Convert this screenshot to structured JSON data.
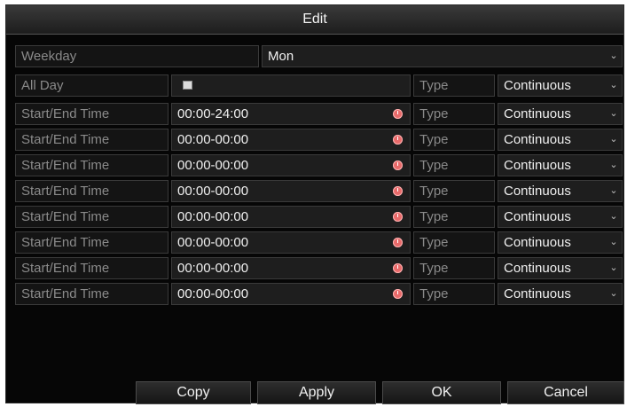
{
  "dialog": {
    "title": "Edit"
  },
  "weekday": {
    "label": "Weekday",
    "value": "Mon"
  },
  "all_day": {
    "label": "All Day",
    "type_label": "Type",
    "type_value": "Continuous"
  },
  "periods": [
    {
      "label": "Start/End Time",
      "time": "00:00-24:00",
      "type_label": "Type",
      "type_value": "Continuous"
    },
    {
      "label": "Start/End Time",
      "time": "00:00-00:00",
      "type_label": "Type",
      "type_value": "Continuous"
    },
    {
      "label": "Start/End Time",
      "time": "00:00-00:00",
      "type_label": "Type",
      "type_value": "Continuous"
    },
    {
      "label": "Start/End Time",
      "time": "00:00-00:00",
      "type_label": "Type",
      "type_value": "Continuous"
    },
    {
      "label": "Start/End Time",
      "time": "00:00-00:00",
      "type_label": "Type",
      "type_value": "Continuous"
    },
    {
      "label": "Start/End Time",
      "time": "00:00-00:00",
      "type_label": "Type",
      "type_value": "Continuous"
    },
    {
      "label": "Start/End Time",
      "time": "00:00-00:00",
      "type_label": "Type",
      "type_value": "Continuous"
    },
    {
      "label": "Start/End Time",
      "time": "00:00-00:00",
      "type_label": "Type",
      "type_value": "Continuous"
    }
  ],
  "buttons": {
    "copy": "Copy",
    "apply": "Apply",
    "ok": "OK",
    "cancel": "Cancel"
  },
  "icons": {
    "dropdown": "chevron-down-icon",
    "clock": "clock-icon",
    "checkbox": "checkbox-icon"
  },
  "colors": {
    "background": "#060606",
    "clock_accent": "#e86a6a",
    "text": "#f0f0f0",
    "label_text": "#8a8a8a"
  }
}
